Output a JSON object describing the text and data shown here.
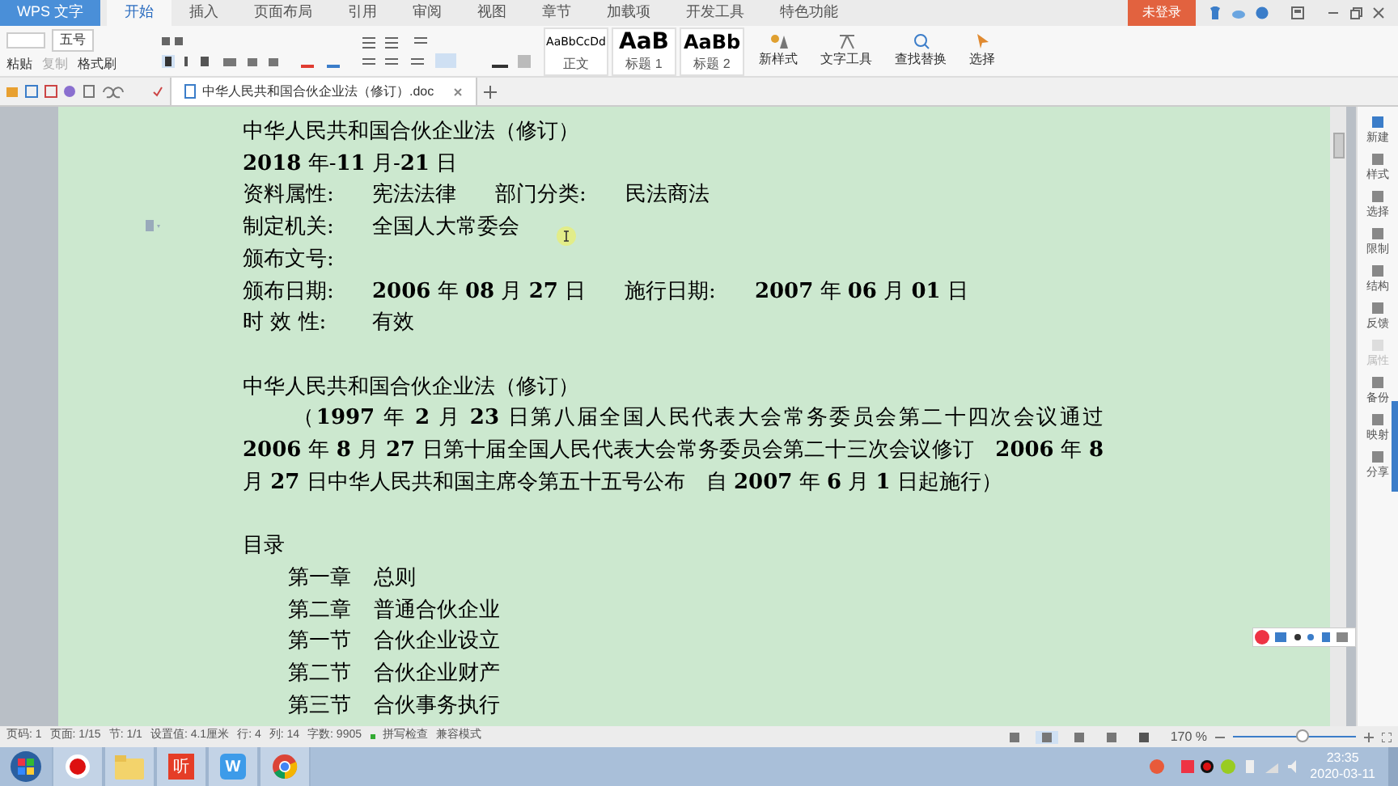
{
  "app_menu": {
    "label": "WPS 文字"
  },
  "ribbon_tabs": [
    {
      "label": "开始",
      "selected": true
    },
    {
      "label": "插入",
      "selected": false
    },
    {
      "label": "页面布局",
      "selected": false
    },
    {
      "label": "引用",
      "selected": false
    },
    {
      "label": "审阅",
      "selected": false
    },
    {
      "label": "视图",
      "selected": false
    },
    {
      "label": "章节",
      "selected": false
    },
    {
      "label": "加载项",
      "selected": false
    },
    {
      "label": "开发工具",
      "selected": false
    },
    {
      "label": "特色功能",
      "selected": false
    }
  ],
  "login_button": "未登录",
  "clipboard": {
    "paste": "粘贴",
    "copy": "复制",
    "format_painter": "格式刷"
  },
  "font_size": "五号",
  "styles": [
    {
      "preview": "AaBbCcDd",
      "name": "正文",
      "kind": "body"
    },
    {
      "preview": "AaB",
      "name": "标题 1",
      "kind": "h1"
    },
    {
      "preview": "AaBb",
      "name": "标题 2",
      "kind": "h2"
    }
  ],
  "tools": [
    "新样式",
    "文字工具",
    "查找替换",
    "选择"
  ],
  "doc_tab": {
    "title": "中华人民共和国合伙企业法（修订）.doc"
  },
  "document": {
    "blocks": [
      {
        "kind": "line",
        "segments": [
          "中华人民共和国合伙企业法（修订）"
        ]
      },
      {
        "kind": "line",
        "segments": [
          "**2018** 年-**11** 月-**21** 日"
        ]
      },
      {
        "kind": "line",
        "segments": [
          "资料属性:",
          "宪法法律",
          "部门分类:",
          "民法商法"
        ]
      },
      {
        "kind": "line",
        "segments": [
          "制定机关:",
          "全国人大常委会"
        ]
      },
      {
        "kind": "line",
        "segments": [
          "颁布文号:"
        ]
      },
      {
        "kind": "line",
        "segments": [
          "颁布日期:",
          "**2006** 年 **08** 月 **27** 日",
          "施行日期:",
          "**2007** 年 **06** 月 **01** 日"
        ]
      },
      {
        "kind": "line",
        "segments": [
          "时 效 性:",
          "有效"
        ]
      },
      {
        "kind": "blank"
      },
      {
        "kind": "line",
        "segments": [
          "中华人民共和国合伙企业法（修订）"
        ]
      },
      {
        "kind": "paragraph",
        "text": "（**1997** 年 **2** 月 **23** 日第八届全国人民代表大会常务委员会第二十四次会议通过　**2006** 年 **8** 月 **27** 日第十届全国人民代表大会常务委员会第二十三次会议修订　**2006** 年 **8** 月 **27** 日中华人民共和国主席令第五十五号公布　自 **2007** 年 **6** 月 **1** 日起施行）"
      },
      {
        "kind": "blank"
      },
      {
        "kind": "line",
        "segments": [
          "目录"
        ]
      },
      {
        "kind": "toc",
        "segments": [
          "第一章",
          "总则"
        ]
      },
      {
        "kind": "toc",
        "segments": [
          "第二章",
          "普通合伙企业"
        ]
      },
      {
        "kind": "toc",
        "segments": [
          "第一节",
          "合伙企业设立"
        ]
      },
      {
        "kind": "toc",
        "segments": [
          "第二节",
          "合伙企业财产"
        ]
      },
      {
        "kind": "toc",
        "segments": [
          "第三节",
          "合伙事务执行"
        ]
      }
    ]
  },
  "sidebar": [
    {
      "label": "新建",
      "disabled": false
    },
    {
      "label": "样式",
      "disabled": false
    },
    {
      "label": "选择",
      "disabled": false
    },
    {
      "label": "限制",
      "disabled": false
    },
    {
      "label": "结构",
      "disabled": false
    },
    {
      "label": "反馈",
      "disabled": false
    },
    {
      "label": "属性",
      "disabled": true
    },
    {
      "label": "备份",
      "disabled": false
    },
    {
      "label": "映射",
      "disabled": false
    },
    {
      "label": "分享",
      "disabled": false
    }
  ],
  "status_bar": [
    "页码: 1",
    "页面: 1/15",
    "节: 1/1",
    "设置值: 4.1厘米",
    "行: 4",
    "列: 14",
    "字数: 9905",
    "拼写检查",
    "兼容模式"
  ],
  "zoom": {
    "reading": "170 %",
    "level": 0.57
  },
  "taskbar": [
    {
      "kind": "start"
    },
    {
      "kind": "record"
    },
    {
      "kind": "folder"
    },
    {
      "kind": "listen",
      "glyph": "听"
    },
    {
      "kind": "wps",
      "glyph": "W"
    },
    {
      "kind": "chrome"
    }
  ],
  "clock": {
    "time": "23:35",
    "date": "2020-03-11"
  }
}
